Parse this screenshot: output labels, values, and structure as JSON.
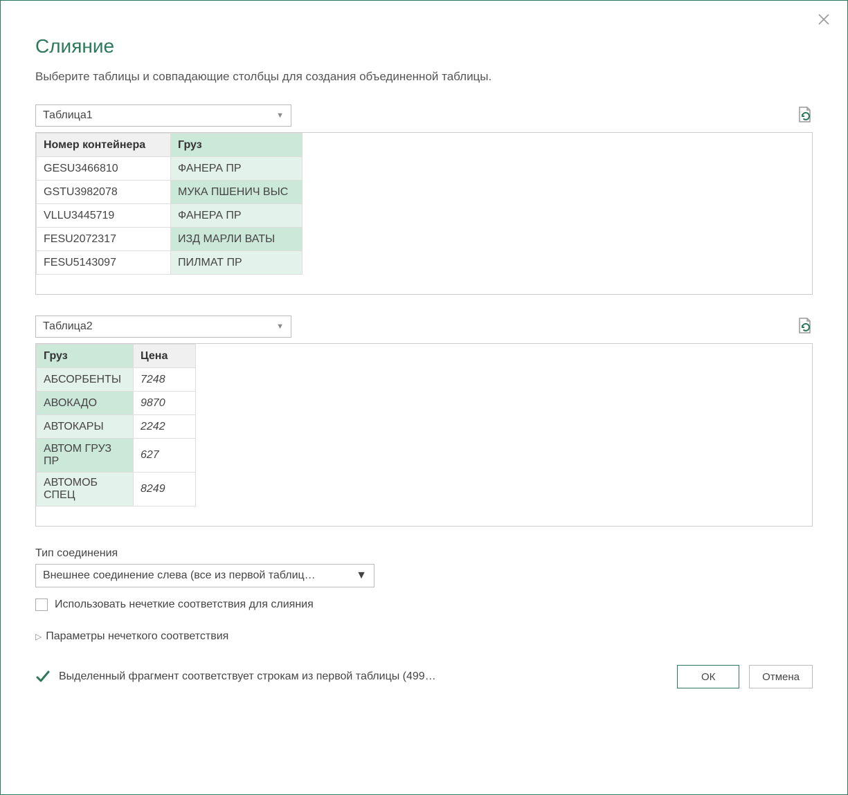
{
  "dialog": {
    "title": "Слияние",
    "subtitle": "Выберите таблицы и совпадающие столбцы для создания объединенной таблицы."
  },
  "table1": {
    "selected": "Таблица1",
    "columns": [
      "Номер контейнера",
      "Груз"
    ],
    "rows": [
      {
        "num": "GESU3466810",
        "cargo": "ФАНЕРА ПР"
      },
      {
        "num": "GSTU3982078",
        "cargo": "МУКА ПШЕНИЧ ВЫС"
      },
      {
        "num": "VLLU3445719",
        "cargo": "ФАНЕРА ПР"
      },
      {
        "num": "FESU2072317",
        "cargo": "ИЗД МАРЛИ ВАТЫ"
      },
      {
        "num": "FESU5143097",
        "cargo": "ПИЛМАТ ПР"
      }
    ]
  },
  "table2": {
    "selected": "Таблица2",
    "columns": [
      "Груз",
      "Цена"
    ],
    "rows": [
      {
        "cargo": "АБСОРБЕНТЫ",
        "price": "7248"
      },
      {
        "cargo": "АВОКАДО",
        "price": "9870"
      },
      {
        "cargo": "АВТОКАРЫ",
        "price": "2242"
      },
      {
        "cargo": "АВТОМ ГРУЗ ПР",
        "price": "627"
      },
      {
        "cargo": "АВТОМОБ СПЕЦ",
        "price": "8249"
      }
    ]
  },
  "join": {
    "label": "Тип соединения",
    "selected": "Внешнее соединение слева (все из первой таблиц…"
  },
  "fuzzy": {
    "checkbox_label": "Использовать нечеткие соответствия для слияния",
    "expander_label": "Параметры нечеткого соответствия"
  },
  "status": {
    "text": "Выделенный фрагмент соответствует строкам из первой таблицы (499…"
  },
  "buttons": {
    "ok": "ОК",
    "cancel": "Отмена"
  }
}
